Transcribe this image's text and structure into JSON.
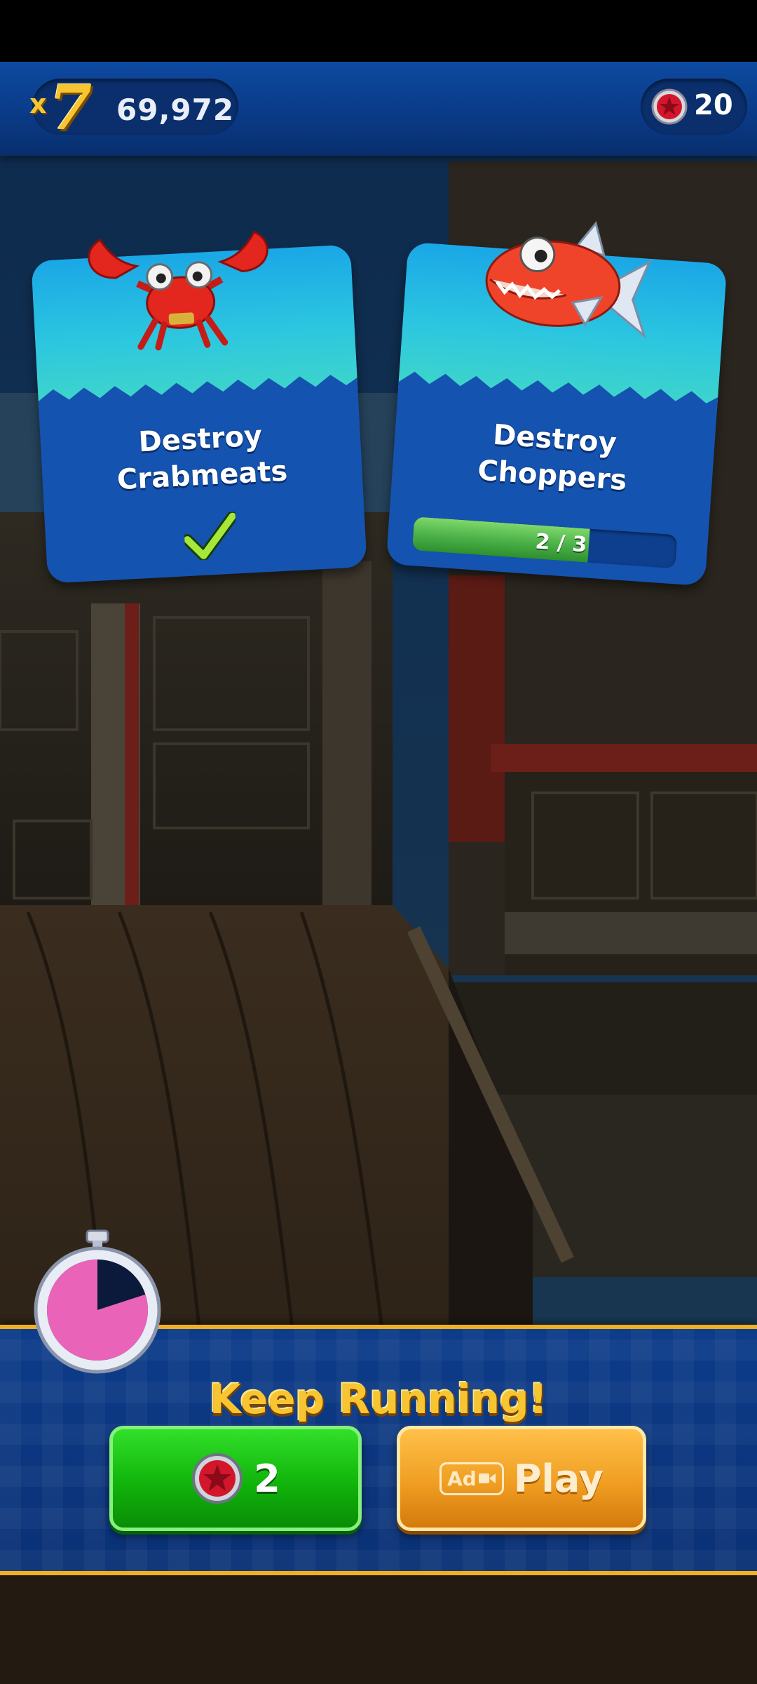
{
  "hud": {
    "multiplier_prefix": "x",
    "multiplier_value": "7",
    "score": "69,972",
    "red_star_rings": "20"
  },
  "missions": [
    {
      "title_line1": "Destroy",
      "title_line2": "Crabmeats",
      "enemy_icon": "crabmeat-icon",
      "status": "complete",
      "status_icon": "checkmark-icon"
    },
    {
      "title_line1": "Destroy",
      "title_line2": "Choppers",
      "enemy_icon": "chopper-fish-icon",
      "status": "in-progress",
      "progress_text": "2 / 3",
      "progress_fraction": 0.667
    }
  ],
  "continue_panel": {
    "title": "Keep Running!",
    "timer_icon": "stopwatch-icon",
    "timer_remaining_fraction": 0.8,
    "rings_button": {
      "icon": "red-star-ring-icon",
      "label": "2"
    },
    "ad_button": {
      "badge": "Ad",
      "badge_icon": "video-camera-icon",
      "label": "Play"
    }
  },
  "colors": {
    "hud_blue": "#0a3a86",
    "gold_text": "#f7c531",
    "green_button": "#11b40b",
    "orange_button": "#f09e22",
    "card_blue": "#1553b0",
    "card_teal": "#2cc6e0"
  }
}
